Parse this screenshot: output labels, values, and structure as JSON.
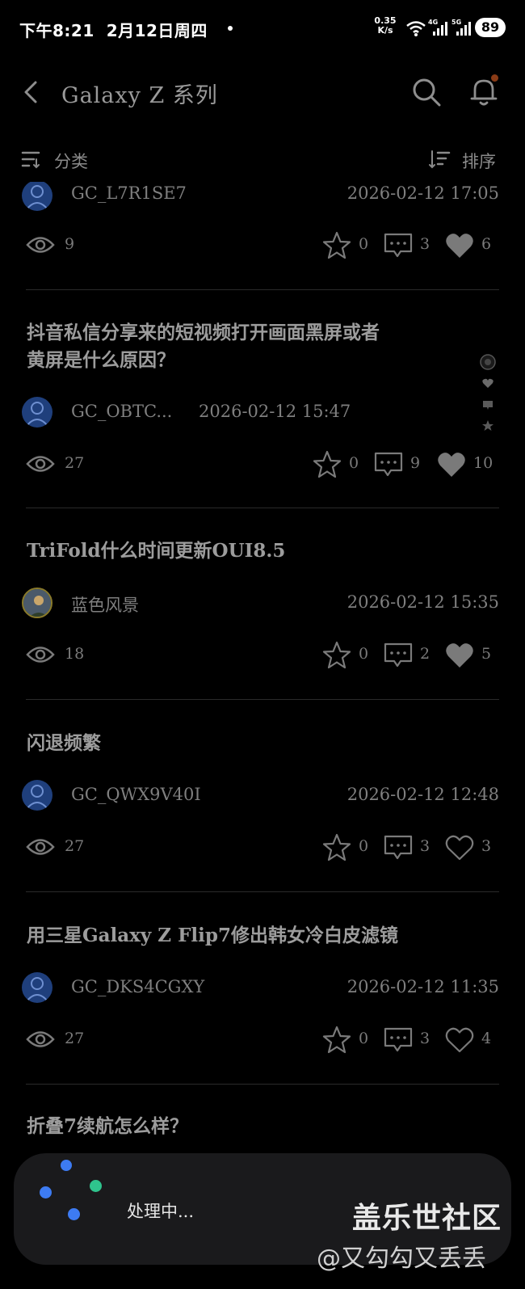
{
  "status_bar": {
    "time": "下午8:21",
    "date": "2月12日周四",
    "net_speed_value": "0.35",
    "net_speed_unit": "K/s",
    "battery": "89"
  },
  "header": {
    "title": "Galaxy Z 系列"
  },
  "filter_bar": {
    "category_label": "分类",
    "sort_label": "排序"
  },
  "posts": [
    {
      "title": "",
      "author": "GC_L7R1SE7",
      "date": "2026-02-12 17:05",
      "views": "9",
      "stars": "0",
      "comments": "3",
      "likes": "6",
      "liked": true
    },
    {
      "title": "抖音私信分享来的短视频打开画面黑屏或者黄屏是什么原因？",
      "author": "GC_OBTC...",
      "date": "2026-02-12 15:47",
      "views": "27",
      "stars": "0",
      "comments": "9",
      "likes": "10",
      "liked": true
    },
    {
      "title": "TriFold什么时间更新OUI8.5",
      "author": "蓝色风景",
      "date": "2026-02-12 15:35",
      "views": "18",
      "stars": "0",
      "comments": "2",
      "likes": "5",
      "liked": true
    },
    {
      "title": "闪退频繁",
      "author": "GC_QWX9V40I",
      "date": "2026-02-12 12:48",
      "views": "27",
      "stars": "0",
      "comments": "3",
      "likes": "3",
      "liked": false
    },
    {
      "title": "用三星Galaxy Z Flip7修出韩女冷白皮滤镜",
      "author": "GC_DKS4CGXY",
      "date": "2026-02-12 11:35",
      "views": "27",
      "stars": "0",
      "comments": "3",
      "likes": "4",
      "liked": false
    },
    {
      "title": "折叠7续航怎么样？"
    }
  ],
  "toast": {
    "text": "处理中..."
  },
  "watermark": {
    "brand": "盖乐世社区",
    "user": "@又勾勾又丢丢"
  },
  "colors": {
    "background": "#000000",
    "toast_bg": "#1a1a1c",
    "spinner_blue": "#3d7bf2",
    "spinner_green": "#2fc48d",
    "notification_dot": "#8a3b16"
  }
}
